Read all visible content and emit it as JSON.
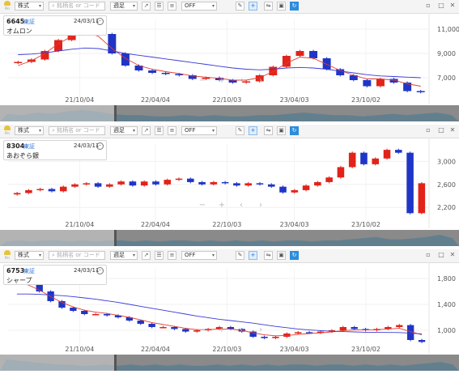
{
  "toolbar": {
    "market": "株式",
    "search_placeholder": "銘柄名 or コード",
    "period": "週足",
    "indicator": "OFF"
  },
  "x_tick_labels": [
    "21/10/04",
    "22/04/04",
    "22/10/03",
    "23/04/03",
    "23/10/02"
  ],
  "colors": {
    "up": "#e2231a",
    "down": "#1f35c7",
    "ma_short": "#e03c31",
    "ma_long": "#3a3ad8",
    "accent": "#2b8ddc"
  },
  "panels": [
    {
      "code": "6645",
      "exchange": "東証",
      "date": "24/03/11",
      "name": "オムロン",
      "y_tick_labels": [
        "11,000",
        "9,000",
        "7,000"
      ],
      "chart_data": {
        "type": "candlestick",
        "x_range": [
          "2021-04",
          "2024-03"
        ],
        "y_ticks": [
          11000,
          9000,
          7000
        ],
        "ylim": [
          5400,
          11800
        ],
        "series": [
          {
            "values": [
              8300,
              8500,
              9200,
              10100,
              10900,
              11400,
              10600,
              9000,
              8000,
              7600,
              7400,
              7300,
              7200,
              6900,
              7000,
              6800,
              6600,
              6700,
              7200,
              7900,
              8800,
              9200,
              8600,
              7700,
              7200,
              6800,
              6300,
              6900,
              6600,
              5900,
              5800
            ]
          }
        ],
        "moving_averages": [
          {
            "color": "ma_short",
            "values": [
              8000,
              8400,
              9000,
              9800,
              10400,
              10800,
              10400,
              9400,
              8600,
              8000,
              7700,
              7500,
              7350,
              7150,
              7050,
              6950,
              6800,
              6800,
              7000,
              7500,
              8200,
              8700,
              8600,
              8100,
              7600,
              7200,
              6900,
              6900,
              6800,
              6500,
              6300
            ]
          },
          {
            "color": "ma_long",
            "values": [
              8900,
              8950,
              9050,
              9200,
              9350,
              9450,
              9400,
              9200,
              9000,
              8850,
              8700,
              8550,
              8400,
              8250,
              8100,
              7950,
              7800,
              7700,
              7650,
              7700,
              7800,
              7850,
              7800,
              7700,
              7550,
              7400,
              7250,
              7150,
              7100,
              7050,
              7000
            ]
          }
        ],
        "volume": [
          6,
          5,
          7,
          6,
          8,
          9,
          8,
          6,
          5,
          5,
          4,
          4,
          5,
          4,
          5,
          4,
          4,
          5,
          5,
          6,
          7,
          6,
          5,
          5,
          4,
          5,
          6,
          5,
          6,
          7,
          5
        ]
      }
    },
    {
      "code": "8304",
      "exchange": "東証",
      "date": "24/03/11",
      "name": "あおぞら銀",
      "y_tick_labels": [
        "3,000",
        "2,600",
        "2,200"
      ],
      "chart_data": {
        "type": "candlestick",
        "x_range": [
          "2021-04",
          "2024-03"
        ],
        "y_ticks": [
          3000,
          2600,
          2200
        ],
        "ylim": [
          1950,
          3300
        ],
        "series": [
          {
            "values": [
              2450,
              2500,
              2520,
              2480,
              2560,
              2600,
              2620,
              2560,
              2600,
              2650,
              2580,
              2650,
              2600,
              2680,
              2700,
              2640,
              2600,
              2640,
              2620,
              2580,
              2620,
              2600,
              2560,
              2460,
              2500,
              2580,
              2640,
              2720,
              2900,
              3150,
              2950,
              3050,
              3200,
              3150,
              2100,
              2620
            ]
          }
        ],
        "volume": [
          4,
          5,
          4,
          5,
          5,
          4,
          5,
          4,
          5,
          5,
          4,
          5,
          4,
          5,
          5,
          4,
          5,
          4,
          5,
          4,
          5,
          4,
          5,
          5,
          4,
          5,
          5,
          6,
          7,
          8,
          6,
          6,
          7,
          8,
          10,
          7
        ]
      }
    },
    {
      "code": "6753",
      "exchange": "東証",
      "date": "24/03/11",
      "name": "シャープ",
      "y_tick_labels": [
        "1,800",
        "1,400",
        "1,000"
      ],
      "chart_data": {
        "type": "candlestick",
        "x_range": [
          "2021-04",
          "2024-03"
        ],
        "y_ticks": [
          1800,
          1400,
          1000
        ],
        "ylim": [
          750,
          1950
        ],
        "series": [
          {
            "values": [
              1900,
              1800,
              1600,
              1450,
              1350,
              1300,
              1250,
              1250,
              1230,
              1200,
              1150,
              1100,
              1050,
              1050,
              1020,
              980,
              1000,
              1020,
              1050,
              1020,
              980,
              900,
              880,
              900,
              950,
              970,
              960,
              980,
              1000,
              1050,
              1020,
              1000,
              1020,
              1050,
              1080,
              850,
              820
            ]
          }
        ],
        "moving_averages": [
          {
            "color": "ma_short",
            "values": [
              1750,
              1700,
              1620,
              1520,
              1430,
              1360,
              1310,
              1280,
              1260,
              1230,
              1200,
              1160,
              1120,
              1090,
              1060,
              1030,
              1010,
              1010,
              1020,
              1020,
              1000,
              960,
              930,
              915,
              920,
              935,
              950,
              960,
              975,
              995,
              1005,
              1005,
              1010,
              1020,
              1030,
              980,
              930
            ]
          },
          {
            "color": "ma_long",
            "values": [
              1560,
              1560,
              1555,
              1545,
              1535,
              1520,
              1500,
              1480,
              1455,
              1430,
              1400,
              1370,
              1340,
              1310,
              1280,
              1250,
              1220,
              1195,
              1170,
              1150,
              1130,
              1110,
              1085,
              1060,
              1040,
              1020,
              1005,
              995,
              985,
              980,
              975,
              970,
              968,
              966,
              965,
              955,
              945
            ]
          }
        ],
        "volume": [
          9,
          8,
          7,
          6,
          5,
          5,
          4,
          4,
          5,
          4,
          5,
          4,
          5,
          4,
          5,
          4,
          4,
          5,
          4,
          5,
          4,
          5,
          4,
          5,
          5,
          4,
          5,
          5,
          4,
          5,
          4,
          5,
          4,
          5,
          6,
          7,
          5
        ]
      }
    }
  ]
}
